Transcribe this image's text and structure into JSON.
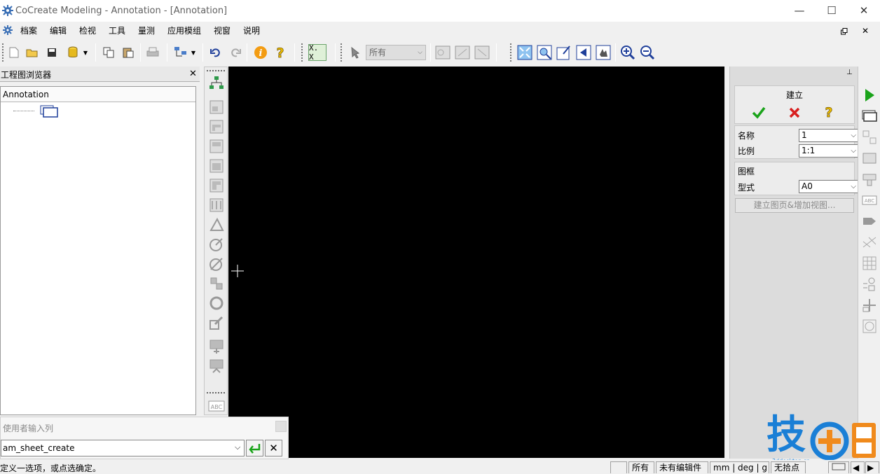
{
  "window": {
    "title": "CoCreate Modeling - Annotation - [Annotation]",
    "minimize": "—",
    "maximize": "☐",
    "close": "✕"
  },
  "menu": [
    "档案",
    "编辑",
    "检视",
    "工具",
    "量测",
    "应用模组",
    "视窗",
    "说明"
  ],
  "toolbar": {
    "filter_value": "所有",
    "formula_label": "X. X"
  },
  "browser": {
    "title": "工程图浏览器",
    "column_header": "Annotation"
  },
  "panel": {
    "create_title": "建立",
    "name_label": "名称",
    "name_value": "1",
    "scale_label": "比例",
    "scale_value": "1:1",
    "frame_section": "图框",
    "type_label": "型式",
    "type_value": "A0",
    "create_sheet_button": "建立图页&增加视图..."
  },
  "user_input": {
    "title": "使用者输入列",
    "command_value": "am_sheet_create"
  },
  "status": {
    "prompt": "定义一选项，或点选确定。",
    "filter": "所有",
    "edit_part": "未有编辑件",
    "units": "mm | deg | g",
    "snap": "无拾点"
  },
  "watermark": {
    "text": "技",
    "url": "3ddesktop.cn"
  },
  "colors": {
    "accent_green": "#1aa31a",
    "cancel_red": "#d81e1e",
    "help_yellow": "#f0c000",
    "canvas": "#000000",
    "watermark_blue": "#1a7fd6",
    "watermark_orange": "#f08a1c"
  }
}
